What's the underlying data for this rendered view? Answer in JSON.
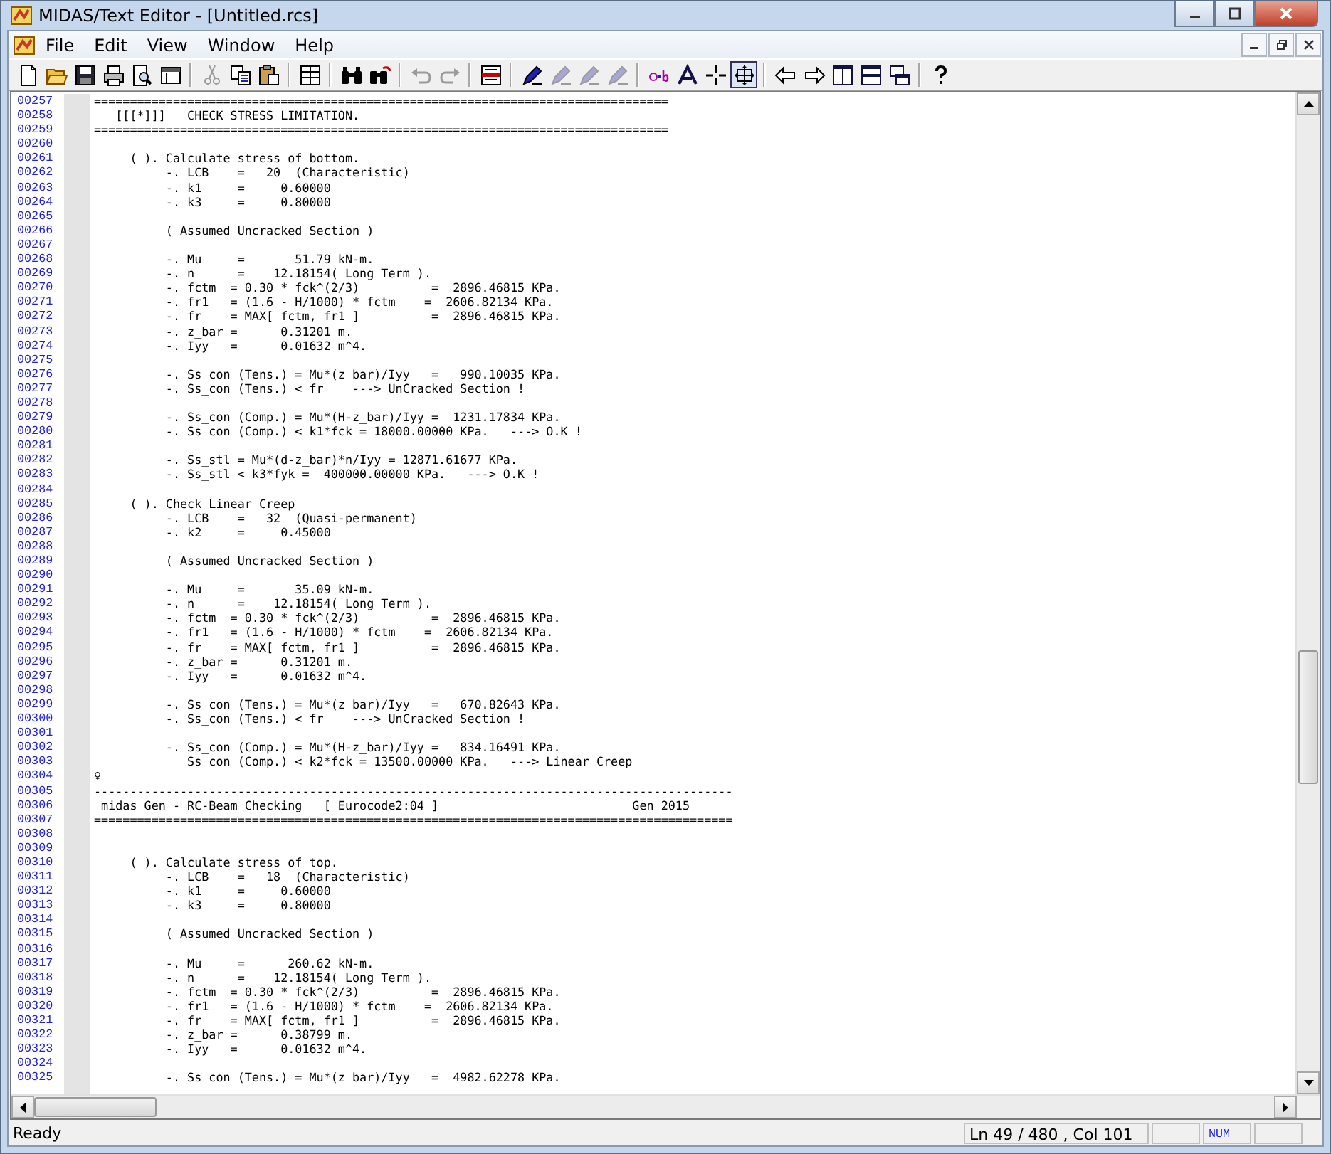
{
  "window": {
    "title": "MIDAS/Text Editor - [Untitled.rcs]"
  },
  "menu": [
    {
      "label": "File"
    },
    {
      "label": "Edit"
    },
    {
      "label": "View"
    },
    {
      "label": "Window"
    },
    {
      "label": "Help"
    }
  ],
  "toolbar": [
    {
      "kind": "new",
      "disabled": false,
      "pressed": false
    },
    {
      "kind": "open",
      "disabled": false,
      "pressed": false
    },
    {
      "kind": "save",
      "disabled": false,
      "pressed": false
    },
    {
      "kind": "print",
      "disabled": false,
      "pressed": false
    },
    {
      "kind": "preview",
      "disabled": false,
      "pressed": false
    },
    {
      "kind": "panel",
      "disabled": false,
      "pressed": false
    },
    {
      "kind": "separator"
    },
    {
      "kind": "cut",
      "disabled": true,
      "pressed": false
    },
    {
      "kind": "copy",
      "disabled": false,
      "pressed": false
    },
    {
      "kind": "paste",
      "disabled": false,
      "pressed": false
    },
    {
      "kind": "separator"
    },
    {
      "kind": "grid",
      "disabled": false,
      "pressed": false
    },
    {
      "kind": "separator"
    },
    {
      "kind": "find",
      "disabled": false,
      "pressed": false
    },
    {
      "kind": "replace",
      "disabled": false,
      "pressed": false
    },
    {
      "kind": "separator"
    },
    {
      "kind": "undo",
      "disabled": true,
      "pressed": false
    },
    {
      "kind": "redo",
      "disabled": true,
      "pressed": false
    },
    {
      "kind": "separator"
    },
    {
      "kind": "bookmark",
      "disabled": false,
      "pressed": false
    },
    {
      "kind": "separator"
    },
    {
      "kind": "pen",
      "disabled": false,
      "pressed": false
    },
    {
      "kind": "pen",
      "disabled": true,
      "pressed": false
    },
    {
      "kind": "pen",
      "disabled": true,
      "pressed": false
    },
    {
      "kind": "pen",
      "disabled": true,
      "pressed": false
    },
    {
      "kind": "separator"
    },
    {
      "kind": "ab",
      "disabled": false,
      "pressed": false
    },
    {
      "kind": "font",
      "disabled": false,
      "pressed": false
    },
    {
      "kind": "cross",
      "disabled": false,
      "pressed": false
    },
    {
      "kind": "move",
      "disabled": false,
      "pressed": true
    },
    {
      "kind": "separator"
    },
    {
      "kind": "left",
      "disabled": false,
      "pressed": false
    },
    {
      "kind": "right",
      "disabled": false,
      "pressed": false
    },
    {
      "kind": "columns",
      "disabled": false,
      "pressed": false
    },
    {
      "kind": "rows",
      "disabled": false,
      "pressed": false
    },
    {
      "kind": "cascade",
      "disabled": false,
      "pressed": false
    },
    {
      "kind": "separator"
    },
    {
      "kind": "help",
      "disabled": false,
      "pressed": false
    }
  ],
  "editor": {
    "lines": [
      {
        "number": "00257",
        "text": "================================================================================"
      },
      {
        "number": "00258",
        "text": "   [[[*]]]   CHECK STRESS LIMITATION."
      },
      {
        "number": "00259",
        "text": "================================================================================"
      },
      {
        "number": "00260"
      },
      {
        "number": "00261",
        "text": "     ( ). Calculate stress of bottom."
      },
      {
        "number": "00262",
        "text": "          -. LCB    =   20  (Characteristic)"
      },
      {
        "number": "00263",
        "text": "          -. k1     =     0.60000"
      },
      {
        "number": "00264",
        "text": "          -. k3     =     0.80000"
      },
      {
        "number": "00265"
      },
      {
        "number": "00266",
        "text": "          ( Assumed Uncracked Section )"
      },
      {
        "number": "00267"
      },
      {
        "number": "00268",
        "text": "          -. Mu     =       51.79 kN-m."
      },
      {
        "number": "00269",
        "text": "          -. n      =    12.18154( Long Term )."
      },
      {
        "number": "00270",
        "text": "          -. fctm  = 0.30 * fck^(2/3)          =  2896.46815 KPa."
      },
      {
        "number": "00271",
        "text": "          -. fr1   = (1.6 - H/1000) * fctm    =  2606.82134 KPa."
      },
      {
        "number": "00272",
        "text": "          -. fr    = MAX[ fctm, fr1 ]          =  2896.46815 KPa."
      },
      {
        "number": "00273",
        "text": "          -. z_bar =      0.31201 m."
      },
      {
        "number": "00274",
        "text": "          -. Iyy   =      0.01632 m^4."
      },
      {
        "number": "00275"
      },
      {
        "number": "00276",
        "text": "          -. Ss_con (Tens.) = Mu*(z_bar)/Iyy   =   990.10035 KPa."
      },
      {
        "number": "00277",
        "text": "          -. Ss_con (Tens.) < fr    ---> UnCracked Section !"
      },
      {
        "number": "00278"
      },
      {
        "number": "00279",
        "text": "          -. Ss_con (Comp.) = Mu*(H-z_bar)/Iyy =  1231.17834 KPa."
      },
      {
        "number": "00280",
        "text": "          -. Ss_con (Comp.) < k1*fck = 18000.00000 KPa.   ---> O.K !"
      },
      {
        "number": "00281"
      },
      {
        "number": "00282",
        "text": "          -. Ss_stl = Mu*(d-z_bar)*n/Iyy = 12871.61677 KPa."
      },
      {
        "number": "00283",
        "text": "          -. Ss_stl < k3*fyk =  400000.00000 KPa.   ---> O.K !"
      },
      {
        "number": "00284"
      },
      {
        "number": "00285",
        "text": "     ( ). Check Linear Creep"
      },
      {
        "number": "00286",
        "text": "          -. LCB    =   32  (Quasi-permanent)"
      },
      {
        "number": "00287",
        "text": "          -. k2     =     0.45000"
      },
      {
        "number": "00288"
      },
      {
        "number": "00289",
        "text": "          ( Assumed Uncracked Section )"
      },
      {
        "number": "00290"
      },
      {
        "number": "00291",
        "text": "          -. Mu     =       35.09 kN-m."
      },
      {
        "number": "00292",
        "text": "          -. n      =    12.18154( Long Term )."
      },
      {
        "number": "00293",
        "text": "          -. fctm  = 0.30 * fck^(2/3)          =  2896.46815 KPa."
      },
      {
        "number": "00294",
        "text": "          -. fr1   = (1.6 - H/1000) * fctm    =  2606.82134 KPa."
      },
      {
        "number": "00295",
        "text": "          -. fr    = MAX[ fctm, fr1 ]          =  2896.46815 KPa."
      },
      {
        "number": "00296",
        "text": "          -. z_bar =      0.31201 m."
      },
      {
        "number": "00297",
        "text": "          -. Iyy   =      0.01632 m^4."
      },
      {
        "number": "00298"
      },
      {
        "number": "00299",
        "text": "          -. Ss_con (Tens.) = Mu*(z_bar)/Iyy   =   670.82643 KPa."
      },
      {
        "number": "00300",
        "text": "          -. Ss_con (Tens.) < fr    ---> UnCracked Section !"
      },
      {
        "number": "00301"
      },
      {
        "number": "00302",
        "text": "          -. Ss_con (Comp.) = Mu*(H-z_bar)/Iyy =   834.16491 KPa."
      },
      {
        "number": "00303",
        "text": "             Ss_con (Comp.) < k2*fck = 13500.00000 KPa.   ---> Linear Creep"
      },
      {
        "number": "00304",
        "text": "♀"
      },
      {
        "number": "00305",
        "text": "-----------------------------------------------------------------------------------------"
      },
      {
        "number": "00306",
        "text": " midas Gen - RC-Beam Checking   [ Eurocode2:04 ]                           Gen 2015"
      },
      {
        "number": "00307",
        "text": "========================================================================================="
      },
      {
        "number": "00308"
      },
      {
        "number": "00309"
      },
      {
        "number": "00310",
        "text": "     ( ). Calculate stress of top."
      },
      {
        "number": "00311",
        "text": "          -. LCB    =   18  (Characteristic)"
      },
      {
        "number": "00312",
        "text": "          -. k1     =     0.60000"
      },
      {
        "number": "00313",
        "text": "          -. k3     =     0.80000"
      },
      {
        "number": "00314"
      },
      {
        "number": "00315",
        "text": "          ( Assumed Uncracked Section )"
      },
      {
        "number": "00316"
      },
      {
        "number": "00317",
        "text": "          -. Mu     =      260.62 kN-m."
      },
      {
        "number": "00318",
        "text": "          -. n      =    12.18154( Long Term )."
      },
      {
        "number": "00319",
        "text": "          -. fctm  = 0.30 * fck^(2/3)          =  2896.46815 KPa."
      },
      {
        "number": "00320",
        "text": "          -. fr1   = (1.6 - H/1000) * fctm    =  2606.82134 KPa."
      },
      {
        "number": "00321",
        "text": "          -. fr    = MAX[ fctm, fr1 ]          =  2896.46815 KPa."
      },
      {
        "number": "00322",
        "text": "          -. z_bar =      0.38799 m."
      },
      {
        "number": "00323",
        "text": "          -. Iyy   =      0.01632 m^4."
      },
      {
        "number": "00324"
      },
      {
        "number": "00325",
        "text": "          -. Ss_con (Tens.) = Mu*(z_bar)/Iyy   =  4982.62278 KPa."
      }
    ]
  },
  "status_bar": {
    "message": "Ready",
    "position": "Ln 49 / 480 , Col 101",
    "indicator": "NUM"
  }
}
